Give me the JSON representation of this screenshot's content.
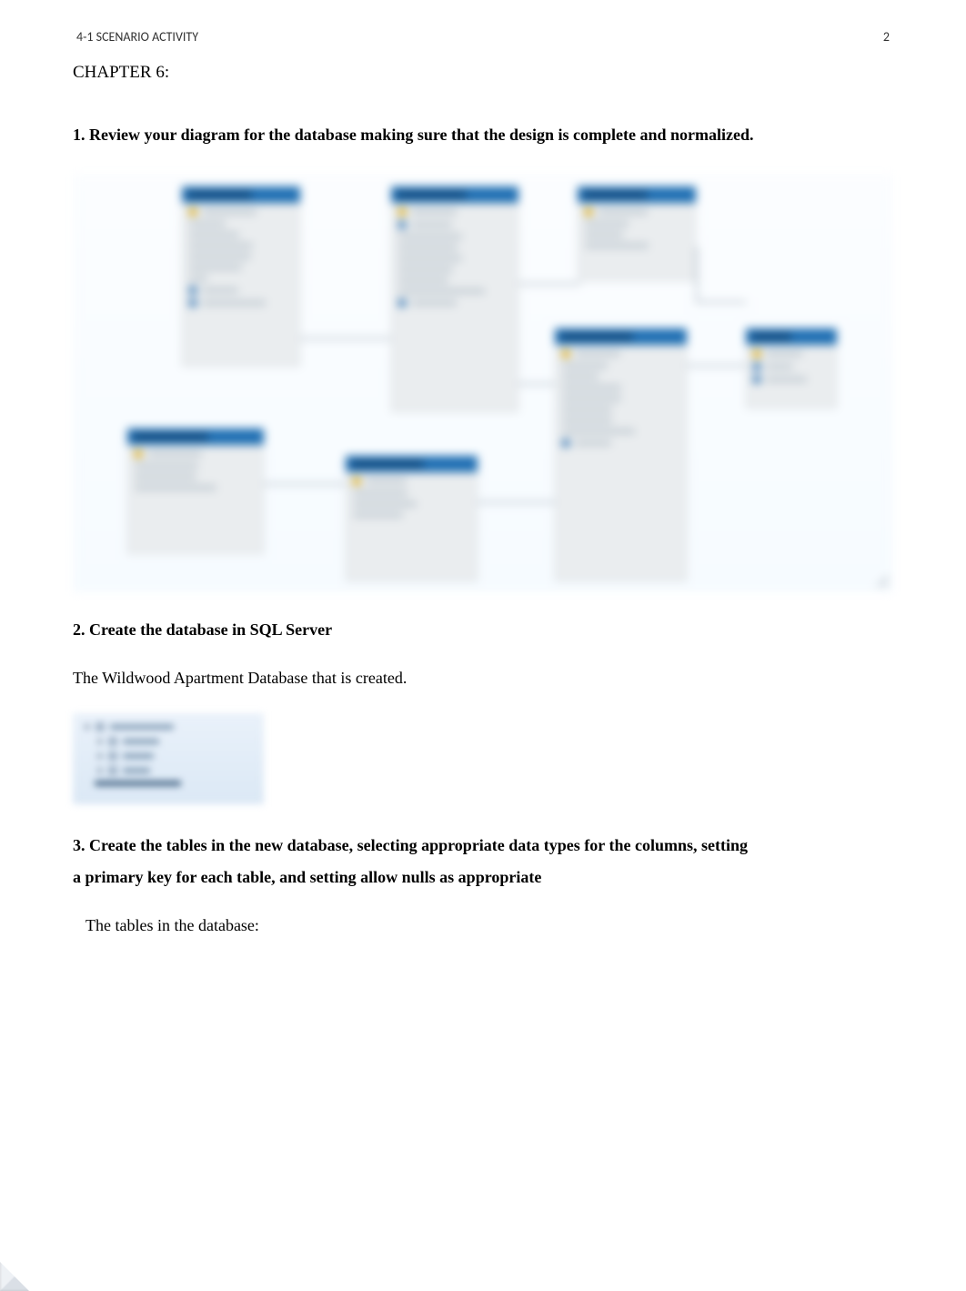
{
  "running_head": {
    "left": "4-1 SCENARIO ACTIVITY",
    "right": "2"
  },
  "chapter_heading": "CHAPTER 6:",
  "q1": "1. Review your diagram for the database making sure that the design is complete and normalized.",
  "q2": "2. Create the database in SQL Server",
  "q2_body": "The Wildwood Apartment Database that is created.",
  "q3_line1": "3. Create the tables in the new database, selecting appropriate data types for the columns, setting",
  "q3_line2": "a primary key for each table, and setting allow nulls as appropriate",
  "q3_body": "The tables in the database:"
}
